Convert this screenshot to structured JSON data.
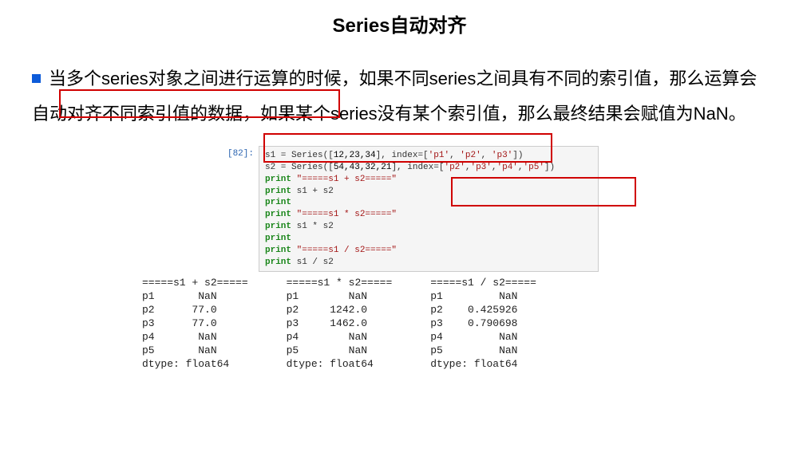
{
  "title": "Series自动对齐",
  "paragraph": "当多个series对象之间进行运算的时候，如果不同series之间具有不同的索引值，那么运算会自动对齐不同索引值的数据，如果某个series没有某个索引值，那么最终结果会赋值为NaN。",
  "cell": {
    "prompt": "[82]:",
    "line1_pre": "s1 = Series([",
    "line1_nums": "12,23,34",
    "line1_mid": "], index=[",
    "line1_idx1": "'p1'",
    "line1_c1": ", ",
    "line1_idx2": "'p2'",
    "line1_c2": ", ",
    "line1_idx3": "'p3'",
    "line1_end": "])",
    "line2_pre": "s2 = Series([",
    "line2_nums": "54,43,32,21",
    "line2_mid": "], index=[",
    "line2_idx1": "'p2'",
    "line2_c1": ",",
    "line2_idx2": "'p3'",
    "line2_c2": ",",
    "line2_idx3": "'p4'",
    "line2_c3": ",",
    "line2_idx4": "'p5'",
    "line2_end": "])",
    "print_kw": "print",
    "sep1": " \"=====s1 + s2=====\"",
    "expr1": " s1 + s2",
    "sep2": " \"=====s1 * s2=====\"",
    "expr2": " s1 * s2",
    "sep3": " \"=====s1 / s2=====\"",
    "expr3": " s1 / s2"
  },
  "outputs": {
    "col1": "=====s1 + s2=====\np1       NaN\np2      77.0\np3      77.0\np4       NaN\np5       NaN\ndtype: float64",
    "col2": "=====s1 * s2=====\np1        NaN\np2     1242.0\np3     1462.0\np4        NaN\np5        NaN\ndtype: float64",
    "col3": "=====s1 / s2=====\np1         NaN\np2    0.425926\np3    0.790698\np4         NaN\np5         NaN\ndtype: float64"
  }
}
